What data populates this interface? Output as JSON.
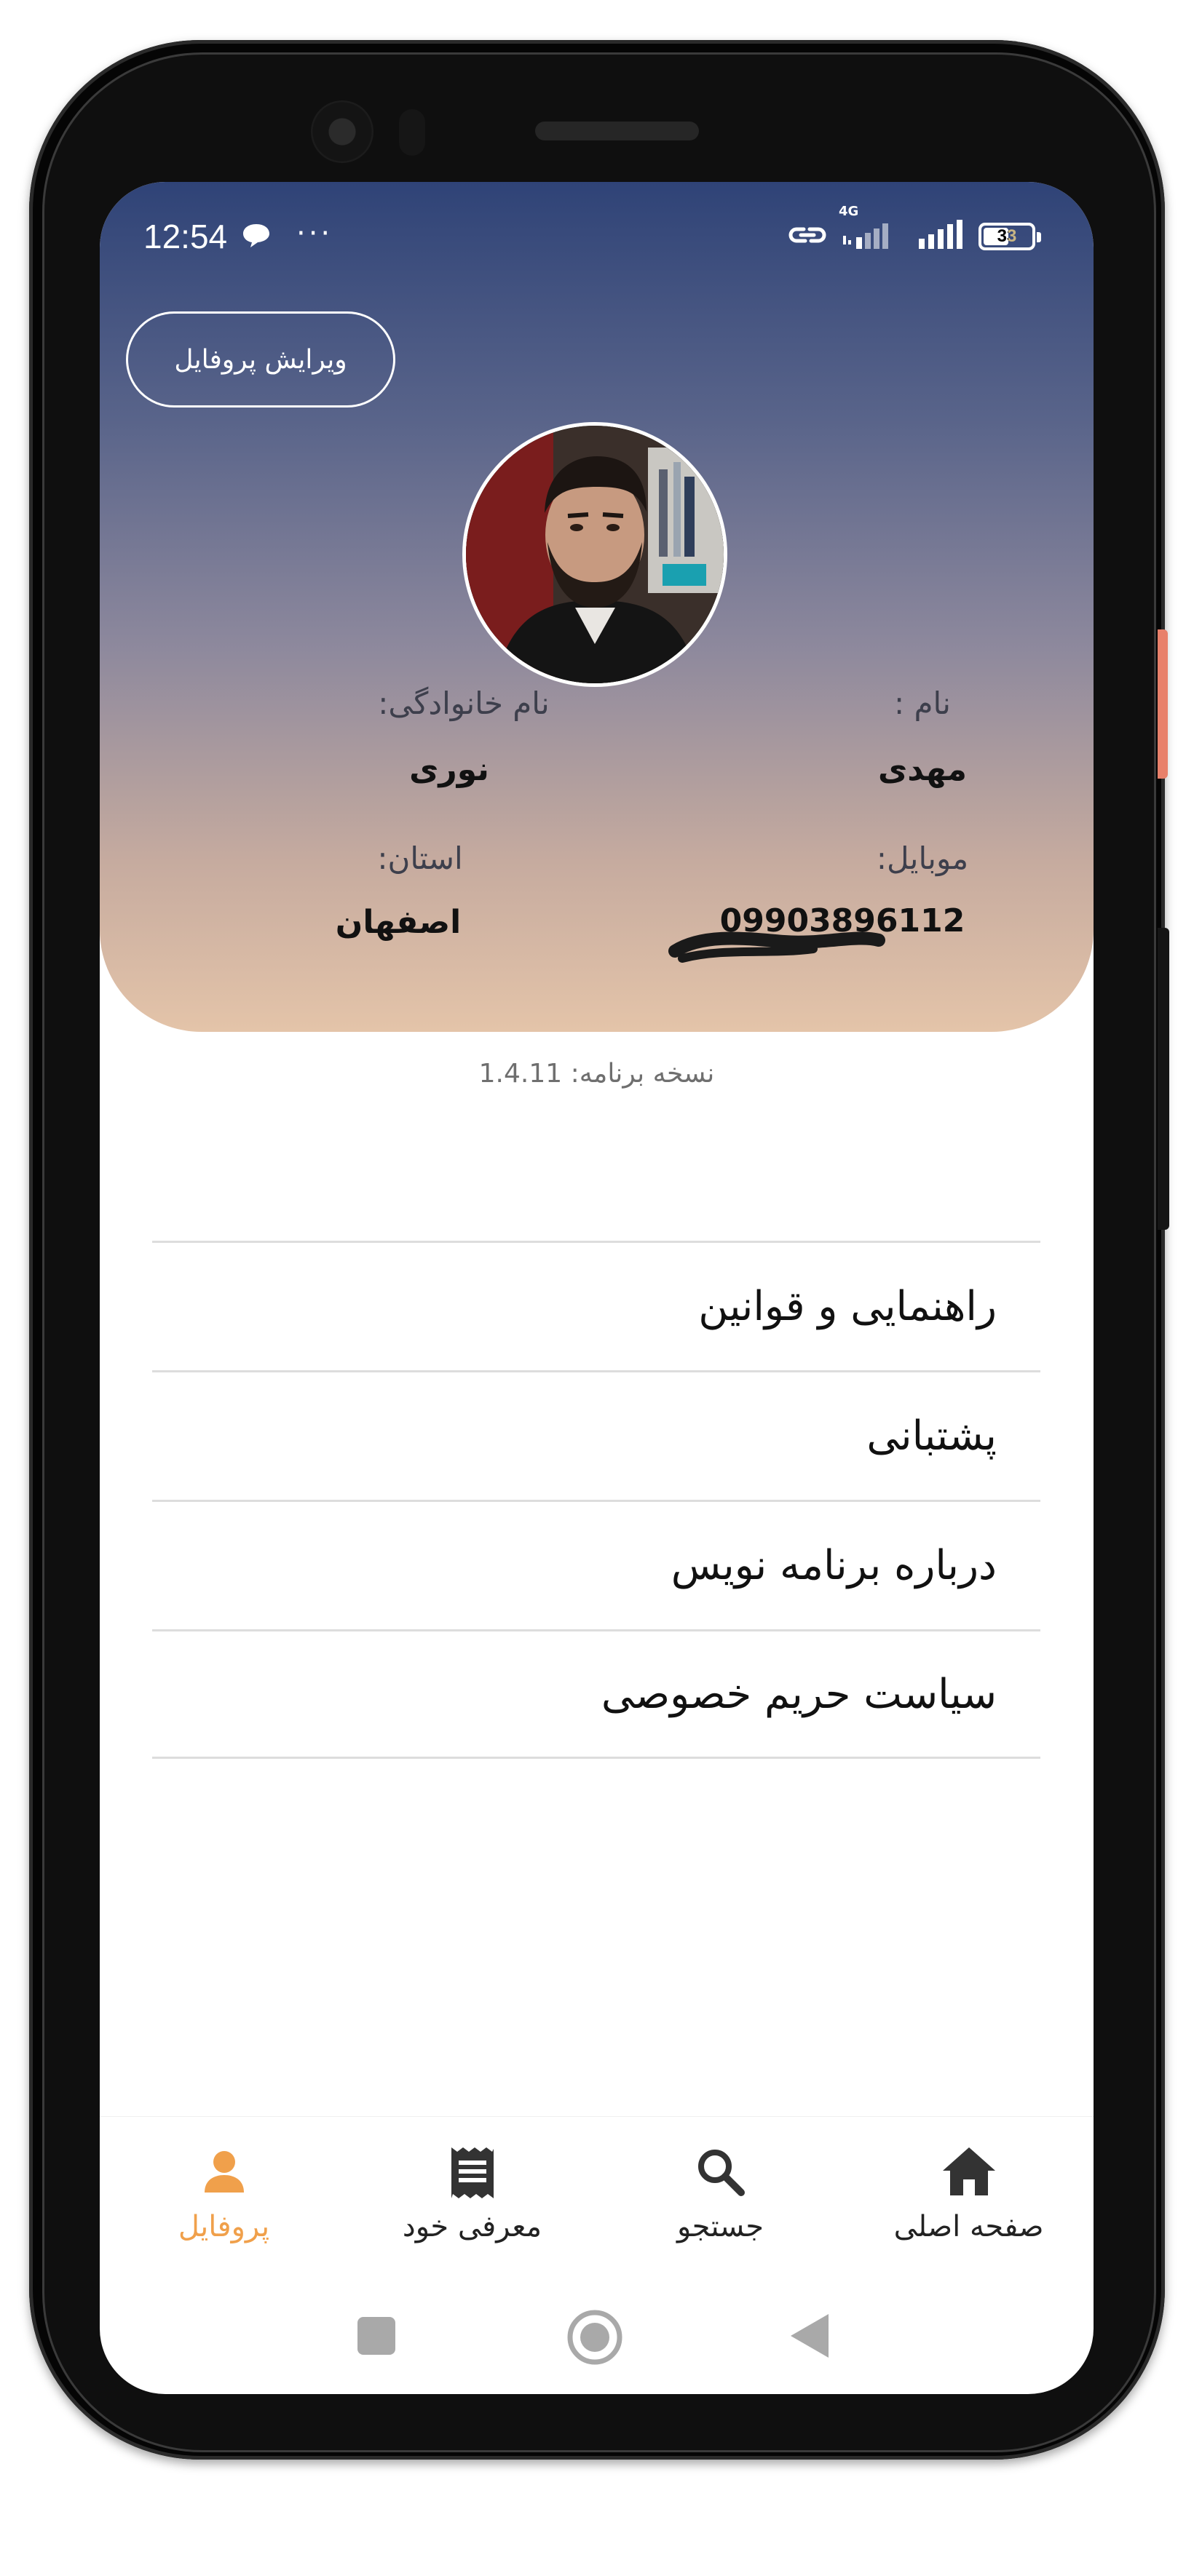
{
  "status_bar": {
    "time": "12:54",
    "network_label": "4G",
    "battery": "33",
    "more": "···"
  },
  "header": {
    "edit_profile_label": "ویرایش پروفایل"
  },
  "profile": {
    "first_name_label": "نام :",
    "first_name": "مهدی",
    "last_name_label": "نام خانوادگی:",
    "last_name": "نوری",
    "mobile_label": "موبایل:",
    "mobile": "09903896112",
    "province_label": "استان:",
    "province": "اصفهان"
  },
  "app": {
    "version_text": "نسخه برنامه: 1.4.11"
  },
  "menu": {
    "items": [
      {
        "label": "راهنمایی و قوانین"
      },
      {
        "label": "پشتبانی"
      },
      {
        "label": "درباره برنامه نویس"
      },
      {
        "label": "سیاست حریم خصوصی"
      }
    ]
  },
  "bottom_nav": {
    "items": [
      {
        "label": "صفحه اصلی",
        "icon": "home-icon"
      },
      {
        "label": "جستجو",
        "icon": "search-icon"
      },
      {
        "label": "معرفی خود",
        "icon": "receipt-icon"
      },
      {
        "label": "پروفایل",
        "icon": "person-icon"
      }
    ],
    "active_color": "#f0a04b"
  },
  "colors": {
    "header_top": "#2f4377",
    "header_bottom": "#e4c4a9",
    "accent": "#f0a04b"
  }
}
